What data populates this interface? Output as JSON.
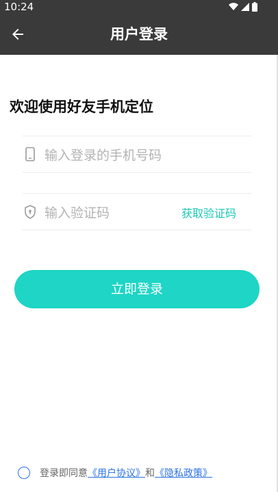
{
  "status_bar": {
    "time": "10:24"
  },
  "app_bar": {
    "title": "用户登录"
  },
  "welcome_text": "欢迎使用好友手机定位",
  "phone_field": {
    "placeholder": "输入登录的手机号码"
  },
  "code_field": {
    "placeholder": "输入验证码",
    "get_code_label": "获取验证码"
  },
  "login_button": {
    "label": "立即登录"
  },
  "agreement": {
    "prefix": "登录即同意",
    "user_agreement": "《用户协议》",
    "and": "和",
    "privacy_policy": "《隐私政策》"
  },
  "colors": {
    "accent": "#1ed5c6",
    "link": "#2b72e8",
    "bar": "#3a3a3a"
  },
  "icons": [
    "back-arrow-icon",
    "phone-icon",
    "shield-icon",
    "wifi-icon",
    "signal-icon",
    "battery-icon"
  ]
}
